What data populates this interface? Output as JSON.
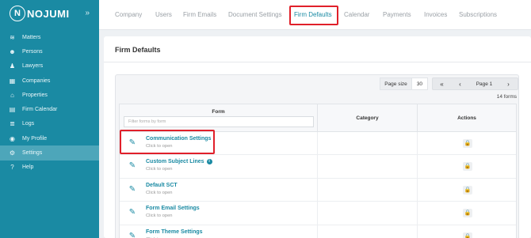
{
  "sidebar": {
    "logo_text": "NOJUMI",
    "logo_mark": "N",
    "collapse_glyph": "»",
    "items": [
      {
        "label": "Matters",
        "icon": "layers-icon",
        "glyph": "≋"
      },
      {
        "label": "Persons",
        "icon": "people-icon",
        "glyph": "☻"
      },
      {
        "label": "Lawyers",
        "icon": "user-icon",
        "glyph": "♟"
      },
      {
        "label": "Companies",
        "icon": "building-icon",
        "glyph": "▦"
      },
      {
        "label": "Properties",
        "icon": "house-icon",
        "glyph": "⌂"
      },
      {
        "label": "Firm Calendar",
        "icon": "calendar-icon",
        "glyph": "▤"
      },
      {
        "label": "Logs",
        "icon": "logs-icon",
        "glyph": "≣"
      },
      {
        "label": "My Profile",
        "icon": "profile-icon",
        "glyph": "◉"
      },
      {
        "label": "Settings",
        "icon": "gear-icon",
        "glyph": "⚙"
      },
      {
        "label": "Help",
        "icon": "help-icon",
        "glyph": "?"
      }
    ],
    "active_index": 8
  },
  "tabs": [
    "Company",
    "Users",
    "Firm Emails",
    "Document Settings",
    "Firm Defaults",
    "Calendar",
    "Payments",
    "Invoices",
    "Subscriptions"
  ],
  "active_tab": "Firm Defaults",
  "main": {
    "title": "Firm Defaults",
    "pager": {
      "size_label": "Page size",
      "size_value": "30",
      "first": "«",
      "prev": "‹",
      "page": "Page 1",
      "next": "›"
    },
    "count": "14 forms",
    "columns": {
      "form": "Form",
      "category": "Category",
      "actions": "Actions"
    },
    "filter_placeholder": "Filter forms by form",
    "rows": [
      {
        "name": "Communication Settings",
        "sub": "Click to open",
        "info": false
      },
      {
        "name": "Custom Subject Lines",
        "sub": "Click to open",
        "info": true
      },
      {
        "name": "Default SCT",
        "sub": "Click to open",
        "info": false
      },
      {
        "name": "Form Email Settings",
        "sub": "Click to open",
        "info": false
      },
      {
        "name": "Form Theme Settings",
        "sub": "Click to open",
        "info": false
      }
    ]
  },
  "colors": {
    "sidebar": "#1a8aa3",
    "accent": "#1a8aa3",
    "highlight": "#e0202a"
  }
}
